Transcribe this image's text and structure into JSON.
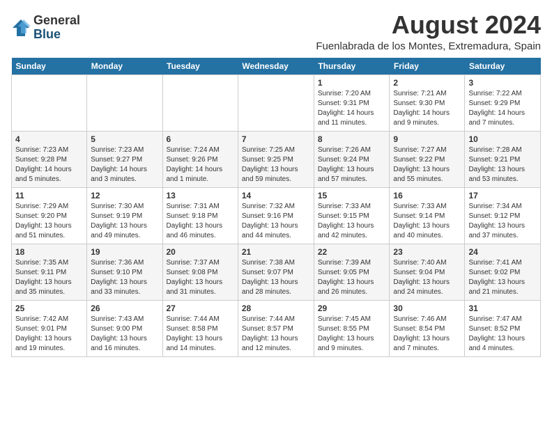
{
  "logo": {
    "text_general": "General",
    "text_blue": "Blue"
  },
  "title": "August 2024",
  "subtitle": "Fuenlabrada de los Montes, Extremadura, Spain",
  "days_of_week": [
    "Sunday",
    "Monday",
    "Tuesday",
    "Wednesday",
    "Thursday",
    "Friday",
    "Saturday"
  ],
  "weeks": [
    [
      {
        "day": "",
        "info": ""
      },
      {
        "day": "",
        "info": ""
      },
      {
        "day": "",
        "info": ""
      },
      {
        "day": "",
        "info": ""
      },
      {
        "day": "1",
        "info": "Sunrise: 7:20 AM\nSunset: 9:31 PM\nDaylight: 14 hours and 11 minutes."
      },
      {
        "day": "2",
        "info": "Sunrise: 7:21 AM\nSunset: 9:30 PM\nDaylight: 14 hours and 9 minutes."
      },
      {
        "day": "3",
        "info": "Sunrise: 7:22 AM\nSunset: 9:29 PM\nDaylight: 14 hours and 7 minutes."
      }
    ],
    [
      {
        "day": "4",
        "info": "Sunrise: 7:23 AM\nSunset: 9:28 PM\nDaylight: 14 hours and 5 minutes."
      },
      {
        "day": "5",
        "info": "Sunrise: 7:23 AM\nSunset: 9:27 PM\nDaylight: 14 hours and 3 minutes."
      },
      {
        "day": "6",
        "info": "Sunrise: 7:24 AM\nSunset: 9:26 PM\nDaylight: 14 hours and 1 minute."
      },
      {
        "day": "7",
        "info": "Sunrise: 7:25 AM\nSunset: 9:25 PM\nDaylight: 13 hours and 59 minutes."
      },
      {
        "day": "8",
        "info": "Sunrise: 7:26 AM\nSunset: 9:24 PM\nDaylight: 13 hours and 57 minutes."
      },
      {
        "day": "9",
        "info": "Sunrise: 7:27 AM\nSunset: 9:22 PM\nDaylight: 13 hours and 55 minutes."
      },
      {
        "day": "10",
        "info": "Sunrise: 7:28 AM\nSunset: 9:21 PM\nDaylight: 13 hours and 53 minutes."
      }
    ],
    [
      {
        "day": "11",
        "info": "Sunrise: 7:29 AM\nSunset: 9:20 PM\nDaylight: 13 hours and 51 minutes."
      },
      {
        "day": "12",
        "info": "Sunrise: 7:30 AM\nSunset: 9:19 PM\nDaylight: 13 hours and 49 minutes."
      },
      {
        "day": "13",
        "info": "Sunrise: 7:31 AM\nSunset: 9:18 PM\nDaylight: 13 hours and 46 minutes."
      },
      {
        "day": "14",
        "info": "Sunrise: 7:32 AM\nSunset: 9:16 PM\nDaylight: 13 hours and 44 minutes."
      },
      {
        "day": "15",
        "info": "Sunrise: 7:33 AM\nSunset: 9:15 PM\nDaylight: 13 hours and 42 minutes."
      },
      {
        "day": "16",
        "info": "Sunrise: 7:33 AM\nSunset: 9:14 PM\nDaylight: 13 hours and 40 minutes."
      },
      {
        "day": "17",
        "info": "Sunrise: 7:34 AM\nSunset: 9:12 PM\nDaylight: 13 hours and 37 minutes."
      }
    ],
    [
      {
        "day": "18",
        "info": "Sunrise: 7:35 AM\nSunset: 9:11 PM\nDaylight: 13 hours and 35 minutes."
      },
      {
        "day": "19",
        "info": "Sunrise: 7:36 AM\nSunset: 9:10 PM\nDaylight: 13 hours and 33 minutes."
      },
      {
        "day": "20",
        "info": "Sunrise: 7:37 AM\nSunset: 9:08 PM\nDaylight: 13 hours and 31 minutes."
      },
      {
        "day": "21",
        "info": "Sunrise: 7:38 AM\nSunset: 9:07 PM\nDaylight: 13 hours and 28 minutes."
      },
      {
        "day": "22",
        "info": "Sunrise: 7:39 AM\nSunset: 9:05 PM\nDaylight: 13 hours and 26 minutes."
      },
      {
        "day": "23",
        "info": "Sunrise: 7:40 AM\nSunset: 9:04 PM\nDaylight: 13 hours and 24 minutes."
      },
      {
        "day": "24",
        "info": "Sunrise: 7:41 AM\nSunset: 9:02 PM\nDaylight: 13 hours and 21 minutes."
      }
    ],
    [
      {
        "day": "25",
        "info": "Sunrise: 7:42 AM\nSunset: 9:01 PM\nDaylight: 13 hours and 19 minutes."
      },
      {
        "day": "26",
        "info": "Sunrise: 7:43 AM\nSunset: 9:00 PM\nDaylight: 13 hours and 16 minutes."
      },
      {
        "day": "27",
        "info": "Sunrise: 7:44 AM\nSunset: 8:58 PM\nDaylight: 13 hours and 14 minutes."
      },
      {
        "day": "28",
        "info": "Sunrise: 7:44 AM\nSunset: 8:57 PM\nDaylight: 13 hours and 12 minutes."
      },
      {
        "day": "29",
        "info": "Sunrise: 7:45 AM\nSunset: 8:55 PM\nDaylight: 13 hours and 9 minutes."
      },
      {
        "day": "30",
        "info": "Sunrise: 7:46 AM\nSunset: 8:54 PM\nDaylight: 13 hours and 7 minutes."
      },
      {
        "day": "31",
        "info": "Sunrise: 7:47 AM\nSunset: 8:52 PM\nDaylight: 13 hours and 4 minutes."
      }
    ]
  ]
}
